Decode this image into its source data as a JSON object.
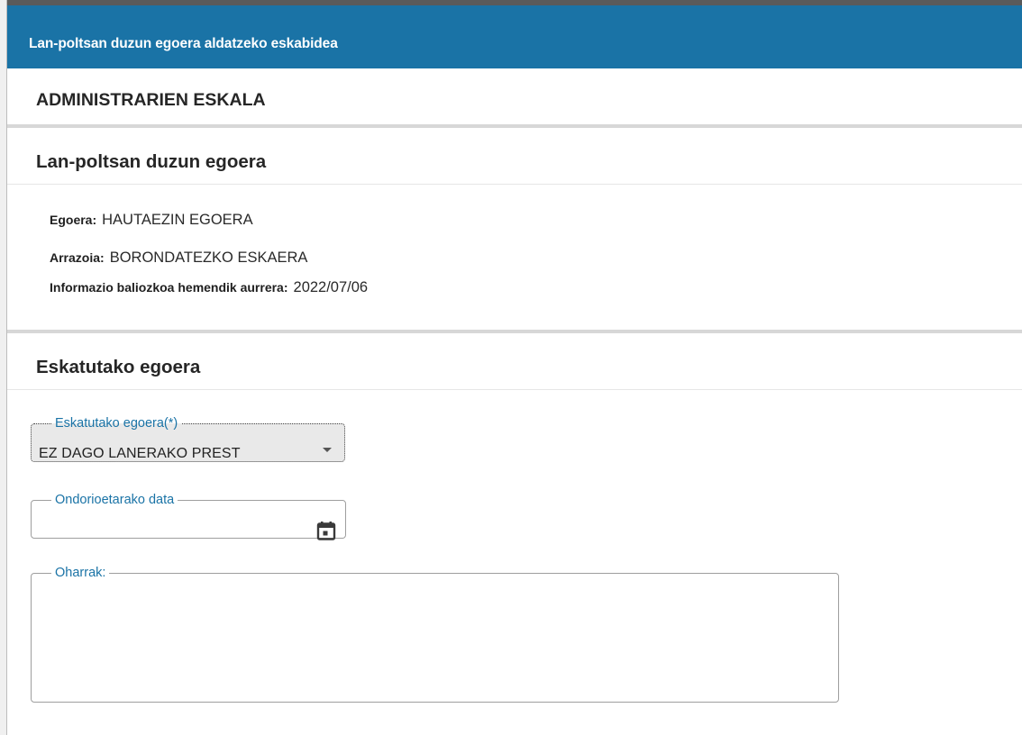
{
  "header": {
    "title": "Lan-poltsan duzun egoera aldatzeko eskabidea"
  },
  "scale": {
    "label": "ADMINISTRARIEN ESKALA"
  },
  "current_status": {
    "title": "Lan-poltsan duzun egoera",
    "fields": [
      {
        "label": "Egoera:",
        "value": "HAUTAEZIN EGOERA"
      },
      {
        "label": "Arrazoia:",
        "value": "BORONDATEZKO ESKAERA"
      },
      {
        "label": "Informazio baliozkoa hemendik aurrera:",
        "value": "2022/07/06"
      }
    ]
  },
  "requested_status": {
    "title": "Eskatutako egoera",
    "status_select": {
      "label": "Eskatutako egoera(*)",
      "value": "EZ DAGO LANERAKO PREST"
    },
    "effective_date": {
      "label": "Ondorioetarako data",
      "value": ""
    },
    "notes": {
      "label": "Oharrak:",
      "value": ""
    }
  },
  "colors": {
    "header_bg": "#1a73a6",
    "accent": "#1a73a6"
  }
}
